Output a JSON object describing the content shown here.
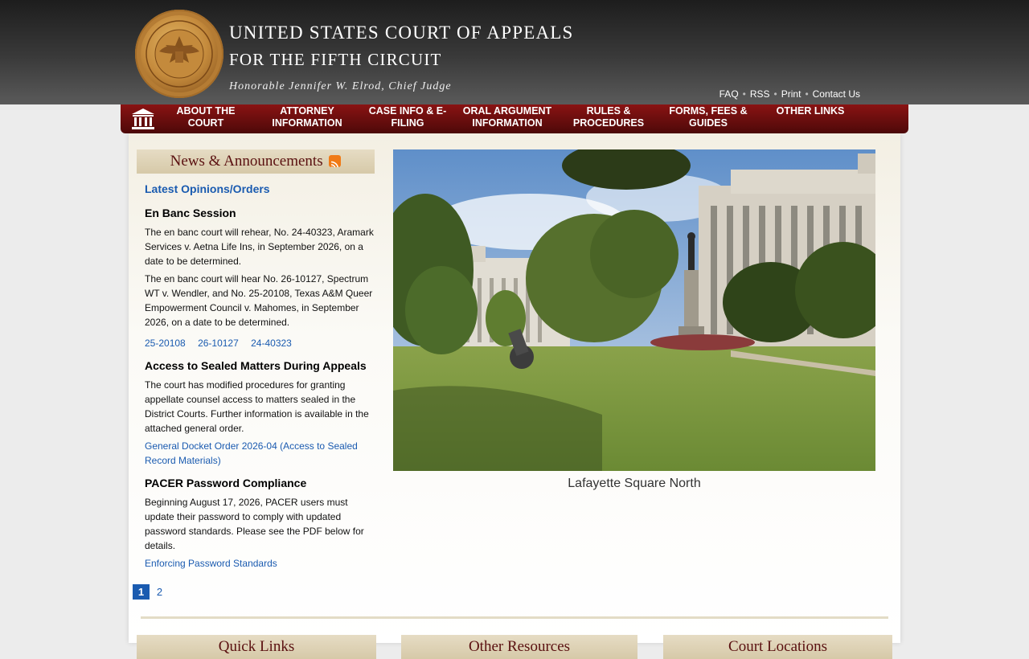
{
  "header": {
    "title_line1": "UNITED STATES COURT OF APPEALS",
    "title_line2": "FOR THE  FIFTH CIRCUIT",
    "title_line3": "Honorable Jennifer W. Elrod, Chief Judge",
    "seal_text": "UNITED STATES COURT OF APPEALS · FIFTH CIRCUIT",
    "utility_links": [
      "FAQ",
      "RSS",
      "Print",
      "Contact Us"
    ]
  },
  "nav": {
    "home_icon": "courthouse-icon",
    "items": [
      {
        "line1": "ABOUT THE",
        "line2": "COURT"
      },
      {
        "line1": "ATTORNEY",
        "line2": "INFORMATION"
      },
      {
        "line1": "CASE INFO & E-",
        "line2": "FILING"
      },
      {
        "line1": "ORAL ARGUMENT",
        "line2": "INFORMATION"
      },
      {
        "line1": "RULES &",
        "line2": "PROCEDURES"
      },
      {
        "line1": "FORMS, FEES &",
        "line2": "GUIDES"
      },
      {
        "line1": "OTHER LINKS",
        "line2": ""
      }
    ]
  },
  "news": {
    "header": "News & Announcements",
    "latest_link": "Latest Opinions/Orders",
    "items": [
      {
        "title": "En Banc Session",
        "p1": "The en banc court will rehear, No. 24-40323, Aramark Services v. Aetna Life Ins, in September 2026, on a date to be determined.",
        "p2": "The en banc court will hear No. 26-10127, Spectrum WT v. Wendler, and No. 25-20108, Texas A&M Queer Empowerment Council v. Mahomes, in September 2026, on a date to be determined.",
        "links": [
          "25-20108",
          "26-10127",
          "24-40323"
        ]
      },
      {
        "title": "Access to Sealed Matters During Appeals",
        "p1": "The court has modified procedures for granting appellate counsel access to matters sealed in the District Courts.  Further information is available in the attached general order.",
        "link": "General Docket Order 2026-04 (Access to Sealed Record Materials)"
      },
      {
        "title": "PACER Password Compliance",
        "p1": "Beginning August 17, 2026, PACER users must update their password to comply with updated password standards.  Please see the PDF below for details.",
        "link": "Enforcing Password Standards"
      }
    ],
    "pager": [
      "1",
      "2"
    ],
    "pager_active": "1"
  },
  "photo": {
    "caption": "Lafayette Square North"
  },
  "bottom_boxes": [
    "Quick Links",
    "Other Resources",
    "Court Locations"
  ],
  "colors": {
    "nav_red": "#6b0e0e",
    "link_blue": "#1a5bb0",
    "panel_tan": "#d6c9a8"
  }
}
